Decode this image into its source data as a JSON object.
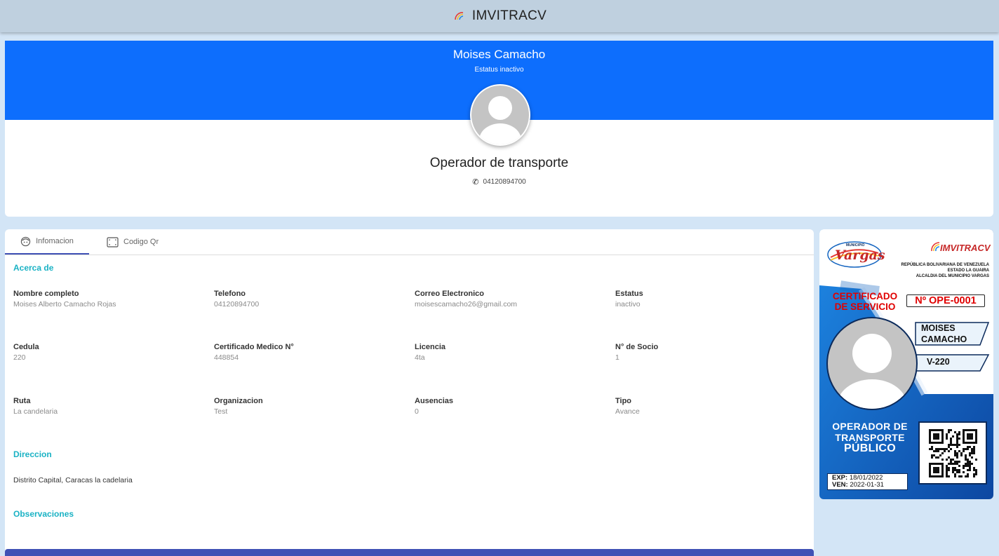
{
  "app": {
    "brand": "IMVITRACV"
  },
  "profile": {
    "name": "Moises Camacho",
    "status": "Estatus inactivo",
    "role": "Operador de transporte",
    "phone": "04120894700"
  },
  "tabs": [
    {
      "label": "Infomacion",
      "icon": "face-icon",
      "active": true
    },
    {
      "label": "Codigo Qr",
      "icon": "qr-scan-icon",
      "active": false
    }
  ],
  "about": {
    "title": "Acerca de",
    "fields": [
      {
        "label": "Nombre completo",
        "value": "Moises Alberto Camacho Rojas"
      },
      {
        "label": "Telefono",
        "value": "04120894700"
      },
      {
        "label": "Correo Electronico",
        "value": "moisescamacho26@gmail.com"
      },
      {
        "label": "Estatus",
        "value": "inactivo"
      },
      {
        "label": "Cedula",
        "value": "220"
      },
      {
        "label": "Certificado Medico N°",
        "value": "448854"
      },
      {
        "label": "Licencia",
        "value": "4ta"
      },
      {
        "label": "N° de Socio",
        "value": "1"
      },
      {
        "label": "Ruta",
        "value": "La candelaria"
      },
      {
        "label": "Organizacion",
        "value": "Test"
      },
      {
        "label": "Ausencias",
        "value": "0"
      },
      {
        "label": "Tipo",
        "value": "Avance"
      }
    ]
  },
  "address": {
    "title": "Direccion",
    "value": "Distrito Capital, Caracas la cadelaria"
  },
  "observations": {
    "title": "Observaciones"
  },
  "id_card": {
    "municipio_logo_text": "Vargas",
    "municipio_small": "MUNICIPIO",
    "imvitracv_logo": "IMVITRACV",
    "header_lines": [
      "REPÚBLICA BOLIVARIANA DE VENEZUELA",
      "ESTADO LA GUAIRA",
      "ALCALDIA DEL MUNICIPIO VARGAS"
    ],
    "cert_line1": "CERTIFICADO",
    "cert_line2": "DE SERVICIO",
    "number": "Nº OPE-0001",
    "name_line1": "MOISES",
    "name_line2": "CAMACHO",
    "id_number": "V-220",
    "role_line1": "OPERADOR DE",
    "role_line2": "TRANSPORTE",
    "role_line3": "PÚBLICO",
    "exp_label": "EXP:",
    "exp_value": "18/01/2022",
    "ven_label": "VEN:",
    "ven_value": "2022-01-31",
    "colors": {
      "blue": "#1565c0",
      "red": "#e00000",
      "navy": "#0b2a5b"
    }
  }
}
